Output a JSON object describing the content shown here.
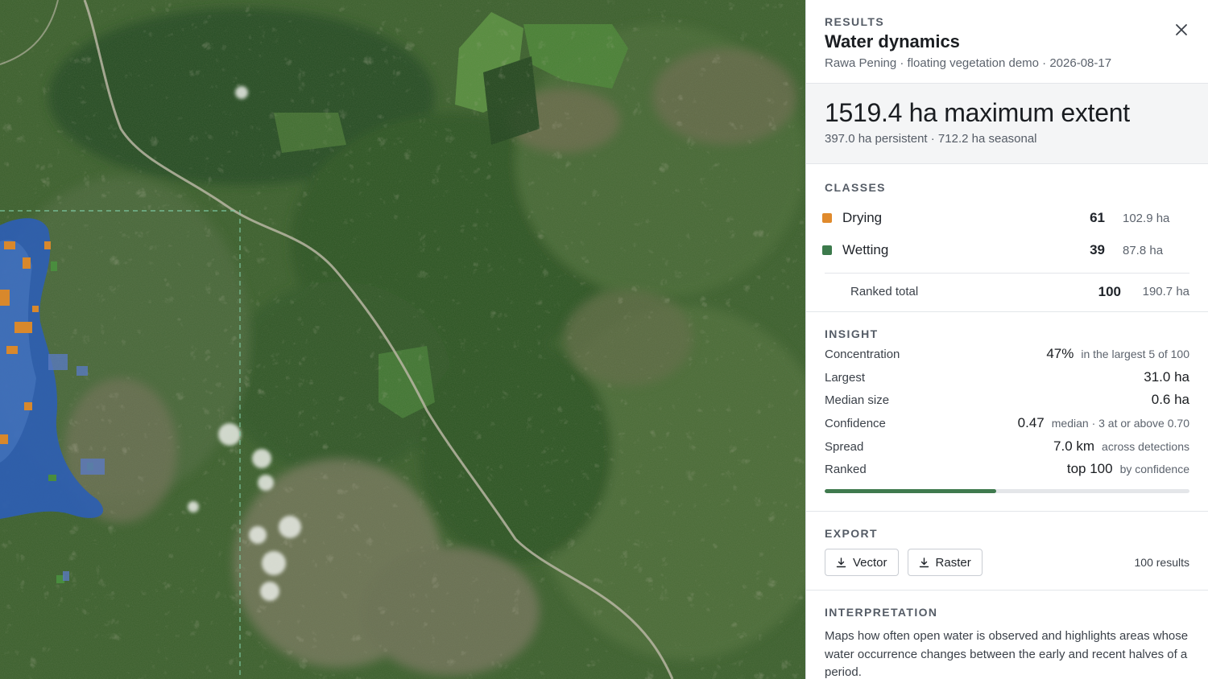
{
  "map": {
    "description_icon": "satellite-map"
  },
  "panel": {
    "eyebrow": "RESULTS",
    "title": "Water dynamics",
    "subtitle": "Rawa Pening · floating vegetation demo · 2026-08-17",
    "close_icon": "close-icon",
    "summary": {
      "headline": "1519.4 ha maximum extent",
      "detail": "397.0 ha persistent · 712.2 ha seasonal"
    },
    "classes": {
      "label": "CLASSES",
      "items": [
        {
          "name": "Drying",
          "count": "61",
          "area": "102.9 ha",
          "color": "#e08a2c"
        },
        {
          "name": "Wetting",
          "count": "39",
          "area": "87.8 ha",
          "color": "#3c7a4c"
        }
      ],
      "total": {
        "label": "Ranked total",
        "count": "100",
        "area": "190.7 ha"
      }
    },
    "insight": {
      "label": "INSIGHT",
      "rows": [
        {
          "key": "Concentration",
          "value": "47%",
          "note": "in the largest 5 of 100"
        },
        {
          "key": "Largest",
          "value": "31.0 ha",
          "note": ""
        },
        {
          "key": "Median size",
          "value": "0.6 ha",
          "note": ""
        },
        {
          "key": "Confidence",
          "value": "0.47",
          "note": "median · 3 at or above 0.70"
        },
        {
          "key": "Spread",
          "value": "7.0 km",
          "note": "across detections"
        },
        {
          "key": "Ranked",
          "value": "top 100",
          "note": "by confidence"
        }
      ],
      "progress": 0.47
    },
    "export": {
      "label": "EXPORT",
      "vector_label": "Vector",
      "raster_label": "Raster",
      "count": "100 results"
    },
    "interpretation": {
      "label": "INTERPRETATION",
      "text": "Maps how often open water is observed and highlights areas whose water occurrence changes between the early and recent halves of a period."
    }
  }
}
